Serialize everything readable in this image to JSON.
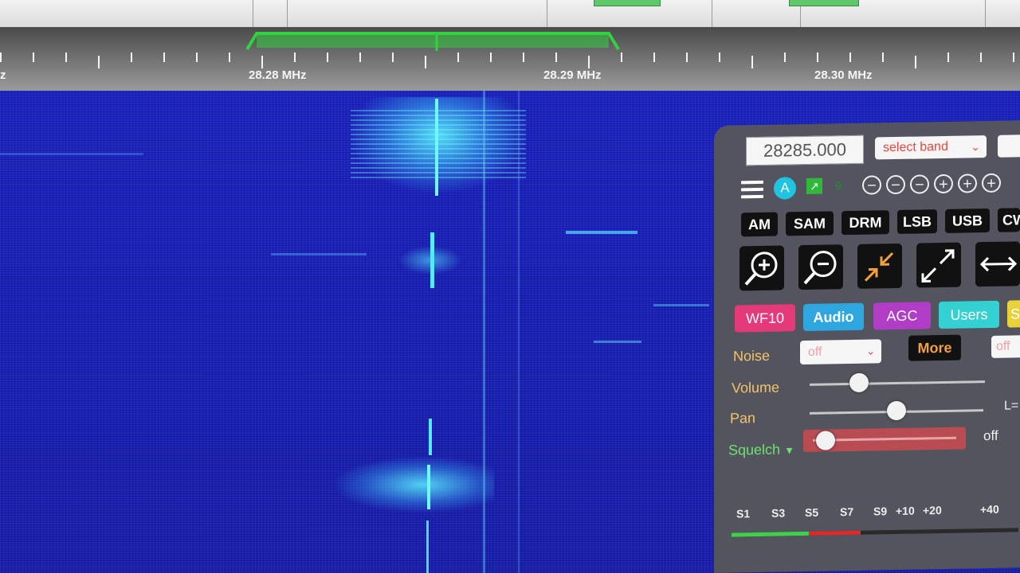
{
  "scale": {
    "freq_labels": [
      "28.28 MHz",
      "28.29 MHz",
      "28.30 MHz"
    ],
    "cut_label": "z"
  },
  "panel": {
    "frequency": "28285.000",
    "band_select": "select band",
    "second_row": {
      "a_label": "A",
      "green_label": "↗",
      "nine_label": "9",
      "zoom_buttons": [
        "−",
        "−",
        "−",
        "+",
        "+",
        "+"
      ]
    },
    "modes": [
      "AM",
      "SAM",
      "DRM",
      "LSB",
      "USB",
      "CW"
    ],
    "tabs": [
      {
        "label": "WF10",
        "color": "#e53a7a"
      },
      {
        "label": "Audio",
        "color": "#2ea6df"
      },
      {
        "label": "AGC",
        "color": "#b13cc6"
      },
      {
        "label": "Users",
        "color": "#33d1d1"
      },
      {
        "label": "S",
        "color": "#e8d23a"
      }
    ],
    "noise": {
      "label": "Noise",
      "value": "off"
    },
    "more_label": "More",
    "off_box": "off",
    "volume": {
      "label": "Volume",
      "level": 0.28
    },
    "pan": {
      "label": "Pan",
      "level": 0.5,
      "side": "L="
    },
    "squelch": {
      "label": "Squelch",
      "value": "off",
      "level": 0.1
    },
    "smeter": {
      "labels": [
        "S1",
        "S3",
        "S5",
        "S7",
        "S9",
        "+10",
        "+20",
        "+40"
      ],
      "level_fraction": 0.45
    }
  },
  "colors": {
    "waterfall": "#1a22b8",
    "signal": "#3ef0ff",
    "passband": "#32d140"
  }
}
